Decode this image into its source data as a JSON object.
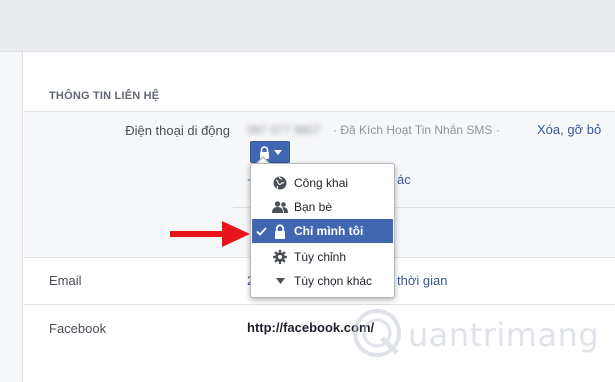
{
  "section": {
    "title": "THÔNG TIN LIÊN HỆ"
  },
  "phone": {
    "label": "Điện thoại di động",
    "number": "097 077 9807",
    "status": "· Đã Kích Hoạt Tin Nhắn SMS ·",
    "remove_link": "Xóa, gỡ bỏ",
    "add_link_head": "+",
    "add_link_tail": "ác"
  },
  "privacy_menu": {
    "items": [
      {
        "label": "Công khai",
        "icon": "globe-icon",
        "selected": false
      },
      {
        "label": "Bạn bè",
        "icon": "friends-icon",
        "selected": false
      },
      {
        "label": "Chỉ mình tôi",
        "icon": "lock-icon",
        "selected": true
      },
      {
        "label": "Tùy chỉnh",
        "icon": "gear-icon",
        "selected": false
      },
      {
        "label": "Tùy chọn khác",
        "icon": "caret-down-icon",
        "selected": false
      }
    ]
  },
  "email": {
    "label": "Email",
    "value_head": "2",
    "value_tail": "thời gian"
  },
  "facebook": {
    "label": "Facebook",
    "value": "http://facebook.com/"
  },
  "watermark": {
    "text": "uantrimang"
  },
  "colors": {
    "accent": "#4267b2",
    "link": "#365899",
    "arrow": "#e8141a"
  }
}
